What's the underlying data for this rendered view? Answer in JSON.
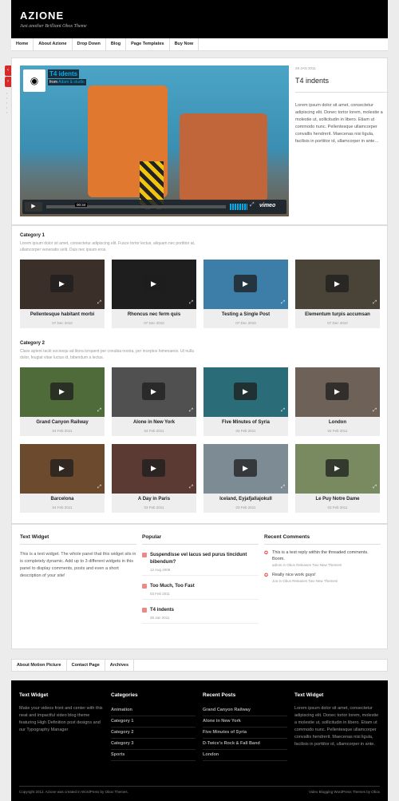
{
  "header": {
    "logo": "AZIONE",
    "tagline": "Just another Brilliant Obox Theme"
  },
  "nav": [
    "Home",
    "About Azione",
    "Drop Down",
    "Blog",
    "Page Templates",
    "Buy Now"
  ],
  "slider": {
    "prev_icon": "chevron-left-icon",
    "next_icon": "chevron-right-icon",
    "dots": "1 2 3 4 5"
  },
  "feature": {
    "video_title": "T4 idents",
    "video_from_prefix": "from",
    "video_from_author": "Adam & studio",
    "video_time": "00:34",
    "vimeo_logo": "vimeo",
    "date": "28 JAN 2011",
    "title": "T4 indents",
    "text": "Lorem ipsum dolor sit amet, consectetur adipiscing elit. Donec tortor lorem, molestie a molestie ut, sollicitudin in libero. Etiam ut commodo nunc. Pellentesque ullamcorper convallis hendrerit. Maecenas nisi ligula, facilisis in porttitor id, ullamcorper in ante…"
  },
  "category1": {
    "title": "Category 1",
    "desc": "Lorem ipsum dolor sit amet, consectetur adipiscing elit. Fusce tortor lectus, aliquam nec porttitor at, ullamcorper venenatis velit. Duis nec ipsum eros.",
    "items": [
      {
        "title": "Pellentesque habitant morbi",
        "date": "07 Dec 2010",
        "color": "#3b2f2a"
      },
      {
        "title": "Rhoncus nec ferm quis",
        "date": "07 Dec 2010",
        "color": "#1e1e1e"
      },
      {
        "title": "Testing a Single Post",
        "date": "07 Dec 2010",
        "color": "#3c7ea8"
      },
      {
        "title": "Elementum turpis accumsan",
        "date": "07 Dec 2010",
        "color": "#4a4438"
      }
    ]
  },
  "category2": {
    "title": "Category 2",
    "desc": "Class aptent taciti sociosqu ad litora torquent per conubia nostra, per inceptos himenaeos. Ut nulla dolor, feugiat vitae luctus id, bibendum a lectus.",
    "items": [
      {
        "title": "Grand Canyon Railway",
        "date": "04 Feb 2011",
        "color": "#4f6b3a"
      },
      {
        "title": "Alone in New York",
        "date": "04 Feb 2011",
        "color": "#505050"
      },
      {
        "title": "Five Minutes of Syria",
        "date": "04 Feb 2011",
        "color": "#2a6d78"
      },
      {
        "title": "London",
        "date": "04 Feb 2011",
        "color": "#6e6258"
      },
      {
        "title": "Barcelona",
        "date": "04 Feb 2011",
        "color": "#6b4a2e"
      },
      {
        "title": "A Day in Paris",
        "date": "03 Feb 2011",
        "color": "#5a3a33"
      },
      {
        "title": "Iceland, Eyjafjallajokull",
        "date": "03 Feb 2011",
        "color": "#7d8b95"
      },
      {
        "title": "Le Puy Notre Dame",
        "date": "03 Feb 2011",
        "color": "#7a8a60"
      }
    ]
  },
  "widgets": {
    "text_title": "Text Widget",
    "text_body": "This is a text widget. The whole panel that this widget sits in is completely dynamic. Add up to 3 different widgets in this panel to display comments, posts and even a short description of your site!",
    "popular_title": "Popular",
    "popular": [
      {
        "title": "Suspendisse vel lacus sed purus tincidunt bibendum?",
        "date": "12 Aug 2009"
      },
      {
        "title": "Too Much, Too Fast",
        "date": "03 Feb 2011"
      },
      {
        "title": "T4 indents",
        "date": "28 Jan 2011"
      }
    ],
    "comments_title": "Recent Comments",
    "comments": [
      {
        "text": "This is a test reply within the threaded comments. Boom.",
        "meta": "admin in Obox Releases Two New Themes!"
      },
      {
        "text": "Really nice work guys!",
        "meta": "Jon in Obox Releases Two New Themes!"
      }
    ]
  },
  "bottom_nav": [
    "About Motion Picture",
    "Contact Page",
    "Archives"
  ],
  "footer": {
    "col1_title": "Text Widget",
    "col1_text": "Make your videos front and center with this neat and impactful video blog theme featuring High Definition post designs and our Typography Manager",
    "col2_title": "Categories",
    "col2_links": [
      "Animation",
      "Category 1",
      "Category 2",
      "Category 3",
      "Sports"
    ],
    "col3_title": "Recent Posts",
    "col3_links": [
      "Grand Canyon Railway",
      "Alone in New York",
      "Five Minutes of Syria",
      "D-Twice's Rock & Fall Band",
      "London"
    ],
    "col4_title": "Text Widget",
    "col4_text": "Lorem ipsum dolor sit amet, consectetur adipiscing elit. Donec tortor lorem, molestie a molestie ut, sollicitudin in libero. Etiam ut commodo nunc. Pellentesque ullamcorper convallis hendrerit. Maecenas nisi ligula, facilisis in porttitor id, ullamcorper in ante.",
    "copyright": "Copyright 2012. Azione was created in WordPress by Obox Themes.",
    "credit": "Video Blogging WordPress Themes by Obox"
  }
}
